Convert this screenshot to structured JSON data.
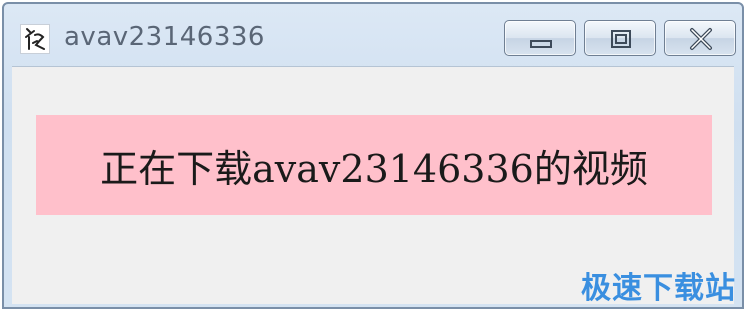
{
  "window": {
    "title": "avav23146336",
    "icon": "app-logo-icon",
    "controls": {
      "minimize": "minimize-icon",
      "maximize": "maximize-icon",
      "close": "close-icon"
    }
  },
  "content": {
    "message": "正在下载avav23146336的视频",
    "banner_color": "#ffc0cb"
  },
  "watermark": {
    "text": "极速下载站",
    "color": "#3a8fe0"
  }
}
